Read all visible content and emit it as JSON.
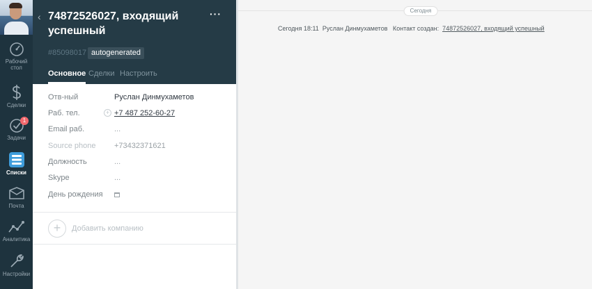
{
  "nav": {
    "items": [
      {
        "label_lines": [
          "Рабочий",
          "стол"
        ],
        "icon": "dashboard-icon"
      },
      {
        "label_lines": [
          "Сделки"
        ],
        "icon": "dollar-icon"
      },
      {
        "label_lines": [
          "Задачи"
        ],
        "icon": "check-icon",
        "badge": "1"
      },
      {
        "label_lines": [
          "Списки"
        ],
        "icon": "lists-icon",
        "active": true
      },
      {
        "label_lines": [
          "Почта"
        ],
        "icon": "mail-icon"
      },
      {
        "label_lines": [
          "Аналитика"
        ],
        "icon": "analytics-icon"
      },
      {
        "label_lines": [
          "Настройки"
        ],
        "icon": "wrench-icon"
      }
    ]
  },
  "card": {
    "title_line1": "74872526027, входящий",
    "title_line2": "успешный",
    "more": "···",
    "id": "#85098017",
    "tag": "autogenerated",
    "tabs": [
      "Основное",
      "Сделки",
      "Настроить"
    ],
    "fields": {
      "responsible": {
        "label": "Отв-ный",
        "value": "Руслан Динмухаметов"
      },
      "work_phone": {
        "label": "Раб. тел.",
        "value": "+7 487 252-60-27"
      },
      "work_email": {
        "label": "Email раб.",
        "value": "..."
      },
      "source_phone": {
        "label": "Source phone",
        "value": "+73432371621"
      },
      "position": {
        "label": "Должность",
        "value": "..."
      },
      "skype": {
        "label": "Skype",
        "value": "..."
      },
      "birthday": {
        "label": "День рождения"
      }
    },
    "add_company": "Добавить компанию"
  },
  "feed": {
    "day": "Сегодня",
    "event": {
      "time": "Сегодня 18:11",
      "author": "Руслан Динмухаметов",
      "action": "Контакт создан:",
      "link": "74872526027, входящий успешный"
    }
  },
  "colors": {
    "nav_bg": "#1e333e",
    "card_header_bg": "#253b46",
    "badge": "#f3686d",
    "active_icon": "#3f9ddb"
  }
}
